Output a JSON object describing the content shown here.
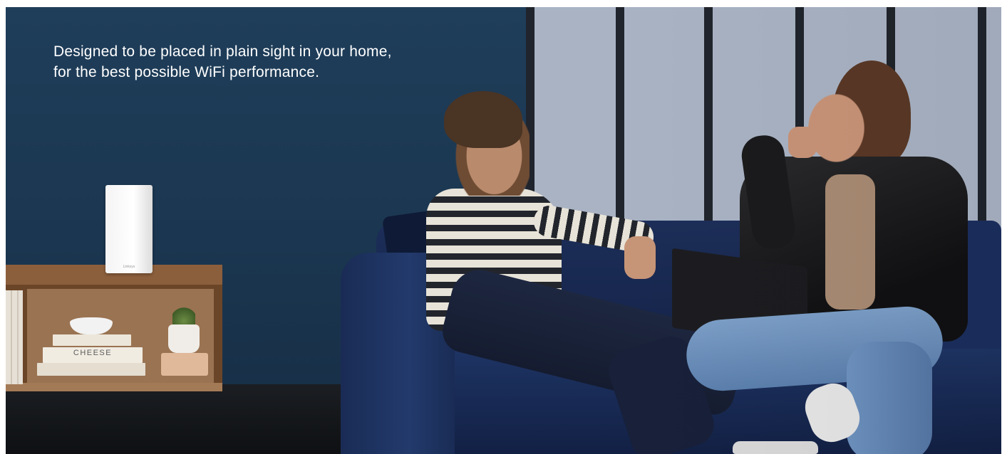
{
  "hero": {
    "headline_line1": "Designed to be placed in plain sight in your home,",
    "headline_line2": "for the best possible WiFi performance."
  },
  "scene": {
    "book_label": "CHEESE",
    "router_logo": "Linksys"
  },
  "colors": {
    "wall": "#1f3e5a",
    "headline_text": "#ffffff",
    "sofa": "#1c2e58"
  }
}
